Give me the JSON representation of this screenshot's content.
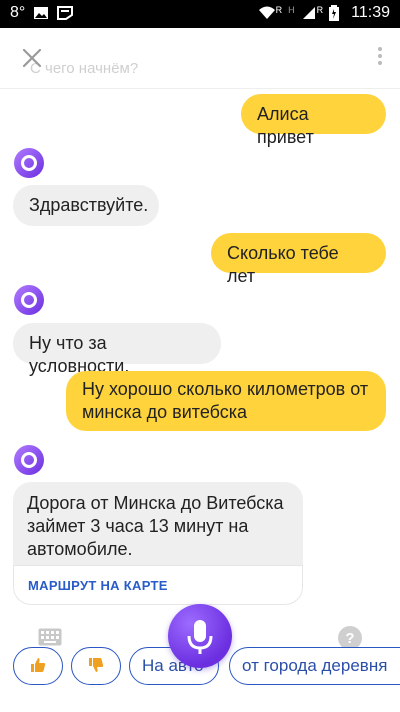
{
  "status_bar": {
    "left_text": "8°",
    "time": "11:39",
    "network_r1": "R",
    "network_h": "H",
    "network_r2": "R",
    "icons": [
      "image-icon",
      "sticker-icon",
      "wifi-icon",
      "signal-icon",
      "battery-icon"
    ]
  },
  "header": {
    "ghost_placeholder": "С чего начнём?",
    "close_icon": "close-icon",
    "menu_icon": "more-vert-icon"
  },
  "conversation": [
    {
      "from": "user",
      "text": "Алиса привет"
    },
    {
      "from": "alice",
      "text": "Здравствуйте."
    },
    {
      "from": "user",
      "text": "Сколько тебе лет"
    },
    {
      "from": "alice",
      "text": "Ну что за условности."
    },
    {
      "from": "user",
      "text": "Ну хорошо сколько километров от минска до витебска"
    },
    {
      "from": "alice",
      "text": "Дорога от Минска до Витебска займет 3 часа 13 минут на автомобиле.",
      "link": "МАРШРУТ НА КАРТЕ"
    }
  ],
  "bottom": {
    "suggestions": [
      "Like",
      "Dislike",
      "На авто",
      "от города деревня"
    ]
  },
  "colors": {
    "user_bubble": "#fed33c",
    "alice_bubble": "#efefef",
    "accent": "#6b2fe0",
    "chip_border": "#2b57c4"
  }
}
